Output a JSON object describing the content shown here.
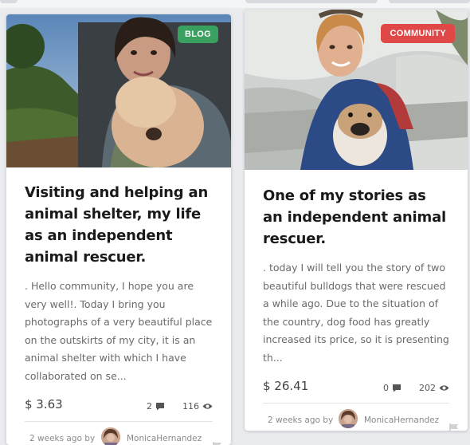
{
  "posts": [
    {
      "badge": "BLOG",
      "badge_color": "#3aa05f",
      "title": "Visiting and helping an animal shelter, my life as an independent animal rescuer.",
      "excerpt": ". Hello community, I hope you are very well!. Today I bring you photographs of a very beautiful place on the outskirts of my city, it is an animal shelter with which I have collaborated on se...",
      "price": "$ 3.63",
      "comments": "2",
      "views": "116",
      "posted": "2 weeks ago by",
      "author": "MonicaHernandez"
    },
    {
      "badge": "COMMUNITY",
      "badge_color": "#e04848",
      "title": "One of my stories as an independent animal rescuer.",
      "excerpt": ". today I will tell you the story of two beautiful bulldogs that were rescued a while ago. Due to the situation of the country, dog food has greatly increased its price, so it is presenting th...",
      "price": "$ 26.41",
      "comments": "0",
      "views": "202",
      "posted": "2 weeks ago by",
      "author": "MonicaHernandez"
    }
  ],
  "icons": {
    "comment": "comment-icon",
    "views": "eye-icon",
    "flag": "flag-icon"
  }
}
